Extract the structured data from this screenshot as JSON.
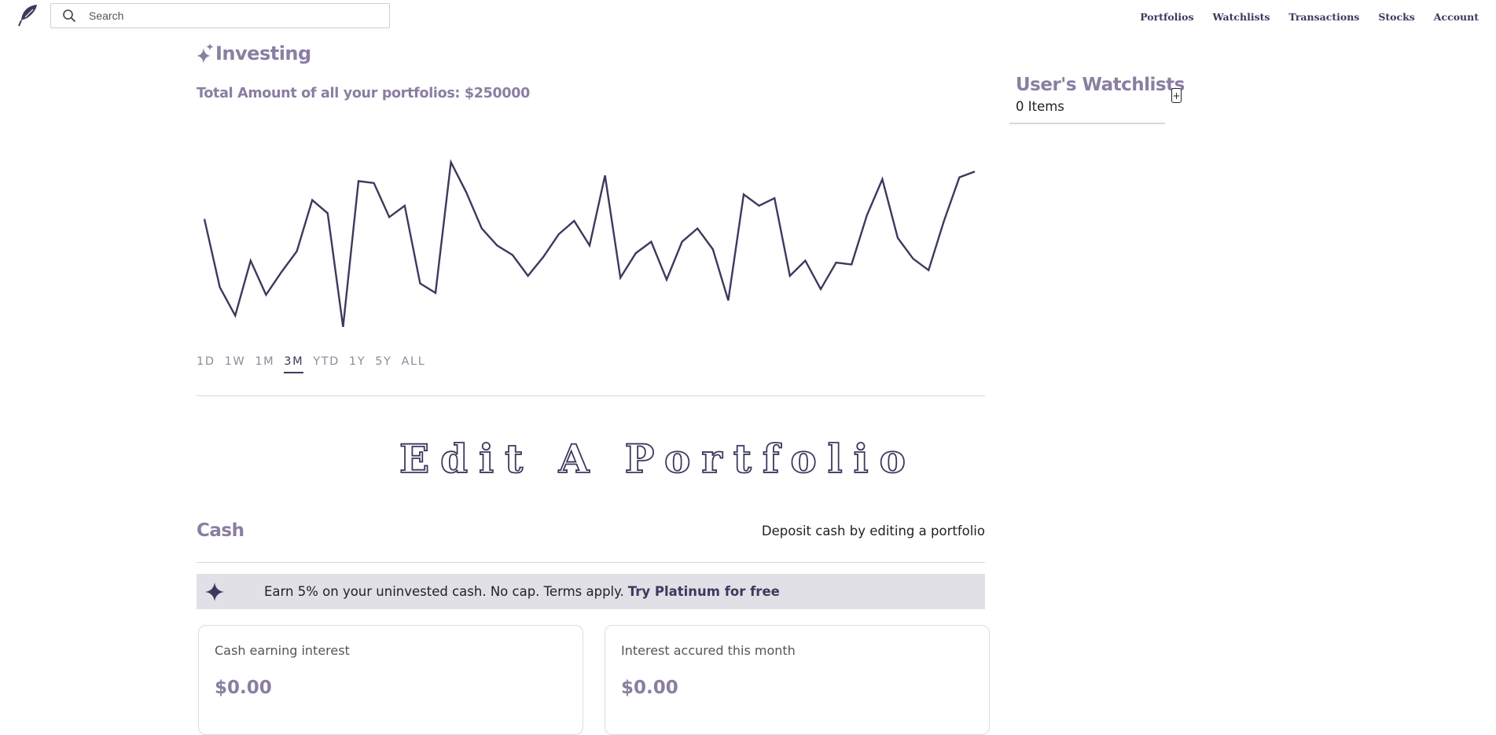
{
  "navbar": {
    "logo_icon": "feather-icon",
    "search": {
      "placeholder": "Search",
      "value": "",
      "icon": "search-icon"
    },
    "links": [
      "Portfolios",
      "Watchlists",
      "Transactions",
      "Stocks",
      "Account"
    ]
  },
  "investing": {
    "icon": "sparkle-icon",
    "title": "Investing",
    "total_text": "Total Amount of all your portfolios: $250000"
  },
  "chart_data": {
    "type": "line",
    "title": "",
    "xlabel": "",
    "ylabel": "",
    "grid": false,
    "axes_visible": false,
    "line_color": "#3b3a5e",
    "values": [
      62,
      26,
      11,
      40,
      22,
      34,
      45,
      72,
      65,
      5,
      82,
      81,
      63,
      69,
      28,
      23,
      92,
      76,
      57,
      48,
      43,
      32,
      42,
      54,
      61,
      48,
      85,
      31,
      44,
      50,
      30,
      50,
      57,
      46,
      19,
      75,
      69,
      73,
      32,
      40,
      25,
      39,
      38,
      64,
      83,
      52,
      41,
      35,
      61,
      84,
      87
    ]
  },
  "time_ranges": {
    "options": [
      "1D",
      "1W",
      "1M",
      "3M",
      "YTD",
      "1Y",
      "5Y",
      "ALL"
    ],
    "selected": "3M"
  },
  "edit_portfolio": {
    "label": "Edit A Portfolio"
  },
  "cash": {
    "title": "Cash",
    "deposit_text": "Deposit cash by editing a portfolio",
    "banner": {
      "icon": "sparkle-icon",
      "text": "Earn 5% on your uninvested cash. No cap. Terms apply.",
      "link": "Try Platinum for free"
    },
    "cards": [
      {
        "label": "Cash earning interest",
        "value": "$0.00"
      },
      {
        "label": "Interest accured this month",
        "value": "$0.00"
      }
    ]
  },
  "watchlists": {
    "title": "User's Watchlists",
    "add_label": "+",
    "count_text": "0 Items"
  },
  "colors": {
    "accent": "#3b3a5e",
    "heading": "#8a7ea1",
    "banner_bg": "#e0e0e6"
  }
}
